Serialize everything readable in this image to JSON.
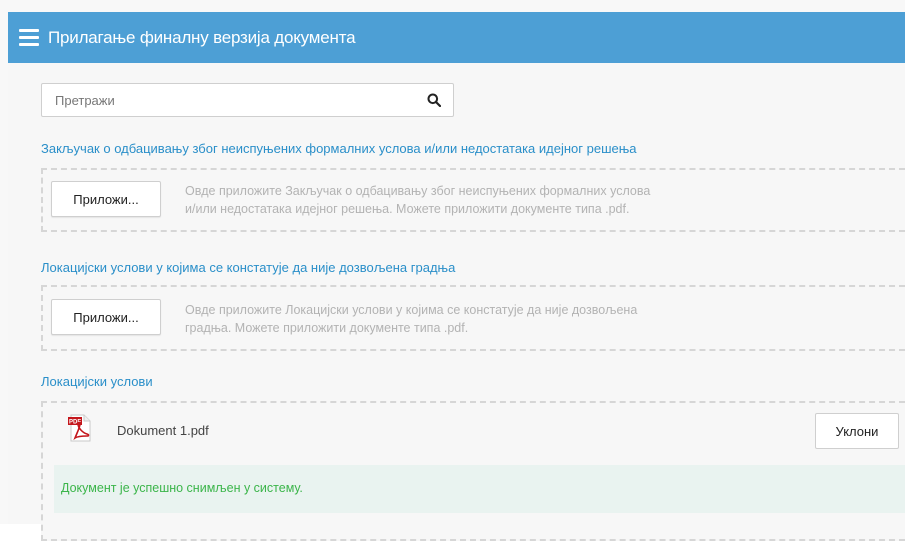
{
  "header": {
    "title": "Прилагање финалну верзија документа",
    "menu_icon": "hamburger-menu-icon",
    "color": "#4d9fd5"
  },
  "search": {
    "placeholder": "Претражи",
    "value": "",
    "icon": "search-icon"
  },
  "sections": [
    {
      "label": "Закључак о одбацивању због неиспуњених формалних услова и/или недостатака идејног решења",
      "button_label": "Приложи...",
      "hint_line1": "Овде приложите Закључак о одбацивању због неиспуњених формалних услова",
      "hint_line2": "и/или недостатака идејног решења. Можете приложити документе типа .pdf."
    },
    {
      "label": "Локацијски услови у којима се констатује да није дозвољена градња",
      "button_label": "Приложи...",
      "hint_line1": "Овде приложите Локацијски услови у којима се констатује да није дозвољена",
      "hint_line2": "градња. Можете приложити документе типа .pdf."
    },
    {
      "label": "Локацијски услови",
      "file": {
        "name": "Dokument 1.pdf",
        "icon": "pdf-file-icon",
        "remove_label": "Уклони"
      },
      "success_message": "Документ је успешно снимљен у систему.",
      "success_color": "#3bb54a"
    }
  ]
}
